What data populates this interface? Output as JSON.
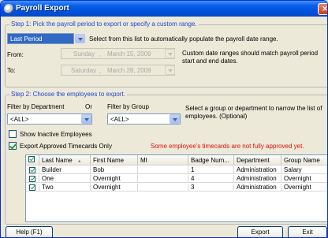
{
  "window": {
    "title": "Payroll Export"
  },
  "step1": {
    "legend": "Step 1: Pick the payroll period to export or specify a custom range.",
    "period_value": "Last Period",
    "period_hint": "Select from this list to automatically populate the payroll date range.",
    "from_label": "From:",
    "from_day": "Sunday",
    "from_date": "March  15, 2009",
    "to_label": "To:",
    "to_day": "Saturday",
    "to_date": "March  28, 2009",
    "custom_note": "Custom date ranges should match payroll period start and end dates."
  },
  "step2": {
    "legend": "Step 2: Choose the employees to export.",
    "dept_label": "Filter by Department",
    "or_label": "Or",
    "group_label": "Filter by Group",
    "dept_value": "<ALL>",
    "group_value": "<ALL>",
    "filter_note": "Select a group or department to narrow the list of employees. (Optional)",
    "show_inactive_label": "Show Inactive Employees",
    "export_approved_label": "Export Approved Timecards Only",
    "warning": "Some employee's timecards are not fully approved yet."
  },
  "table": {
    "columns": [
      "Last Name",
      "First Name",
      "MI",
      "Badge Num...",
      "Department",
      "Group Name"
    ],
    "rows": [
      [
        "Builder",
        "Bob",
        "",
        "1",
        "Administration",
        "Salary"
      ],
      [
        "One",
        "Overnight",
        "",
        "4",
        "Administration",
        "Overnight"
      ],
      [
        "Two",
        "Overnight",
        "",
        "3",
        "Administration",
        "Overnight"
      ]
    ]
  },
  "buttons": {
    "help": "Help (F1)",
    "export": "Export",
    "exit": "Exit"
  },
  "colors": {
    "title_bar": "#0053e0",
    "legend": "#2145d2",
    "warning": "#e01010",
    "selection": "#316ac5"
  }
}
